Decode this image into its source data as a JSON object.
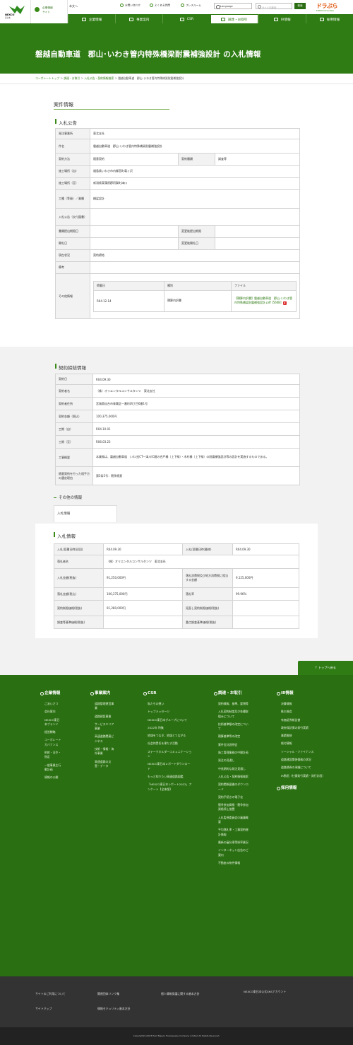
{
  "header": {
    "logo_name": "NEXCO",
    "logo_sub": "東日本",
    "corp_switch": [
      "企業情報",
      "サイト"
    ],
    "honsha": "本文へ",
    "util": [
      "お問い合わせ",
      "よくある質問",
      "プレスルーム"
    ],
    "language_label": "Language",
    "search_placeholder": "サイト内検索",
    "search_button": "検索",
    "brand_right": "ドラぷら",
    "brand_right_sub": "E-NEXCO Drive Plaza"
  },
  "nav": [
    {
      "label": "企業情報",
      "icon": "building-icon"
    },
    {
      "label": "事業案内",
      "icon": "road-icon"
    },
    {
      "label": "CSR",
      "icon": "heart-icon"
    },
    {
      "label": "調達・お取引",
      "icon": "handshake-icon",
      "active": true
    },
    {
      "label": "IR情報",
      "icon": "chart-icon"
    },
    {
      "label": "採用情報",
      "icon": "person-icon"
    }
  ],
  "page_title": "磐越自動車道　郡山･いわき管内特殊橋梁耐震補強設計 の入札情報",
  "breadcrumb": [
    "コーポレートトップ",
    "調達・お取引",
    "入札公告・契約情報検索",
    "磐越自動車道　郡山･いわき管内特殊橋梁耐震補強設計"
  ],
  "case_heading": "案件情報",
  "koukoku": {
    "heading": "入札公告",
    "rows": [
      {
        "label": "発注事業所",
        "value": "東北支社"
      },
      {
        "label": "件名",
        "value": "磐越自動車道　郡山･いわき管内特殊橋梁耐震補強設計"
      },
      {
        "label": "契約方法",
        "value": "随意契約",
        "label2": "契約種類",
        "value2": "調査等"
      },
      {
        "label": "施工場所（自）",
        "value": "福島県いわき市内郷宮町竜ヶ沢"
      },
      {
        "label": "施工場所（至）",
        "value": "新潟県東蒲原郡阿賀町津川"
      },
      {
        "label": "工種（等級）／業種",
        "value": "橋梁設計"
      },
      {
        "label": "入札公告（交付図書）",
        "value": ""
      },
      {
        "label": "書類提出期限日",
        "value": "",
        "label2": "変更後提出期限",
        "value2": ""
      },
      {
        "label": "開札日",
        "value": "",
        "label2": "変更後開札日",
        "value2": ""
      },
      {
        "label": "現在状況",
        "value": "契約締結"
      },
      {
        "label": "備考",
        "value": ""
      }
    ],
    "other_label": "その他情報",
    "other_headers": [
      "掲載日",
      "種別",
      "ファイル"
    ],
    "other_row": {
      "date": "R04.12.14",
      "type": "積算内訳書",
      "file": "【積算内訳書】磐越自動車道　郡山･いわき管内特殊橋梁耐震補強設計.pdf [56KB]"
    }
  },
  "keiyaku": {
    "heading": "契約締結情報",
    "rows": [
      {
        "label": "契約日",
        "value": "R04.09.30"
      },
      {
        "label": "契約者名",
        "value": "（株）オリエンタルコンサルタンツ　東北支社"
      },
      {
        "label": "契約者住所",
        "value": "宮城県仙台市青葉区一番町四丁目6番1号"
      },
      {
        "label": "契約金額（税込）",
        "value": "100,375,000円"
      },
      {
        "label": "工期（自）",
        "value": "R04.10.01"
      },
      {
        "label": "工期（至）",
        "value": "R06.03.23"
      },
      {
        "label": "工事概要",
        "value": "本業務は、磐越自動車道　いわきJCT～津川IC間の合戸橋（上下線）・木村橋（上下線）の耐震補強設計等の設計を実施するものである。"
      },
      {
        "label": "随意契約を行った相手方の選定理由",
        "value": "第5条5号：競争随意"
      }
    ]
  },
  "other_info": {
    "heading": "その他の情報",
    "tab": "入札情報"
  },
  "nyusatsu": {
    "heading": "入札情報",
    "rows": [
      {
        "label": "入札/見積日時(初回)",
        "value": "R04.09.30",
        "label2": "入札/見積日時(最終)",
        "value2": "R04.09.30"
      },
      {
        "label": "落札者名",
        "value": "（株）オリエンタルコンサルタンツ　東北支社"
      },
      {
        "label": "入札金額(税抜)",
        "value": "91,250,000円",
        "label2": "落札消費税及び地方消費税に相当する金額",
        "value2": "9,125,000円"
      },
      {
        "label": "落札金額(税込)",
        "value": "100,375,000円",
        "label2": "落札率",
        "value2": "99.96%"
      },
      {
        "label": "契約制限価格(税抜)",
        "value": "91,280,000円",
        "label2": "見直し契約制限価格(税抜)",
        "value2": ""
      },
      {
        "label": "調査等基準価格(税抜)",
        "value": "",
        "label2": "重点調査基準価格(税抜)",
        "value2": ""
      }
    ]
  },
  "to_top": "トップへ戻る",
  "footer": {
    "cols": [
      {
        "title": "企業情報",
        "items": [
          "ごあいさつ",
          "会社案内",
          "NEXCO東日本ブランド",
          "経営戦略",
          "コーポレートガバナンス",
          "約款・法令・指定",
          "一般事業主行動計画",
          "情報の公開"
        ]
      },
      {
        "title": "事業案内",
        "items": [
          "道路管理運営事業",
          "道路建設事業",
          "サービスエリア事業",
          "高速道路関連ビジネス",
          "技術・情報・海外事業",
          "高速道路の災害・データ"
        ]
      },
      {
        "title": "CSR",
        "items": [
          "私たちの想い",
          "トップメッセージ",
          "NEXCO東日本グループについて",
          "2022年 特集",
          "地域をつなぎ、地域とつながる",
          "社会的責任を果たす活動",
          "ステークホルダーコミュニケーション",
          "NEXCO東日本レポートダウンロード",
          "もっと知りたい高速道路図鑑",
          "「NEXCO東日本レポート2022」アンケート【全体版】"
        ]
      },
      {
        "title": "調達・お取引",
        "items": [
          "契約情報、基準、要領等",
          "入札契約制度及び各種取組みについて",
          "技術基準類の改定について",
          "積算基準等の改定",
          "案件会計説明会",
          "施工管理業務の中間計画",
          "発注の見通し",
          "中長期的な発注見通し",
          "入札公告・契約情報検索",
          "契約関係図書のダウンロード",
          "契約手続きの電子化",
          "競争参加資格・競争参加資格停止措置",
          "入札監視委員会の審議概要",
          "平均落札率・工事契約総計情報",
          "最新の審台車等掛率業況",
          "インターネット広告のご案内",
          "不動産の物件情報"
        ]
      },
      {
        "title": "IR情報",
        "items": [
          "決算情報",
          "株主総会",
          "有価証券報告書",
          "政府保証債の発行実績",
          "業績推移",
          "格付情報",
          "ソーシャル・ファイナンス",
          "道路建設関係債務の状況",
          "道路債券の承継について",
          "IR動画（社債発行実績・発行計画）"
        ]
      },
      {
        "title": "採用情報",
        "items": []
      }
    ],
    "bottom_links": [
      "サイトのご利用について",
      "関連団体リンク集",
      "個人情報保護に関する基本方針",
      "サイトマップ",
      "情報セキュリティ基本方針"
    ],
    "sns_title": "NEXCO東日本公式SNSアカウント",
    "copyright": "Copyright(C)2023 East Nippon Expressway Company Limited All Rights Reserved."
  },
  "colors": {
    "brand_green": "#2f7c14",
    "accent_orange": "#e0530a"
  }
}
